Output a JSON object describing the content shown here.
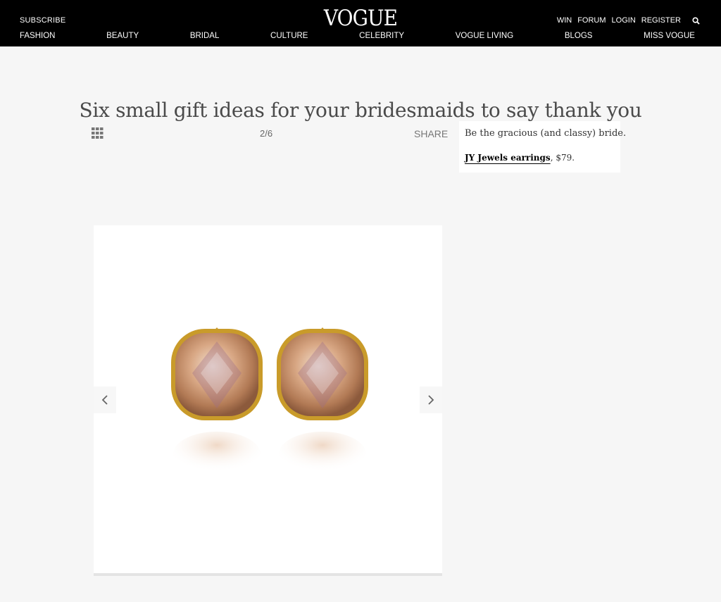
{
  "header": {
    "subscribe": "SUBSCRIBE",
    "logo": "VOGUE",
    "utility": [
      "WIN",
      "FORUM",
      "LOGIN",
      "REGISTER"
    ],
    "nav": [
      "FASHION",
      "BEAUTY",
      "BRIDAL",
      "CULTURE",
      "CELEBRITY",
      "VOGUE LIVING",
      "BLOGS",
      "MISS VOGUE"
    ]
  },
  "article": {
    "title": "Six small gift ideas for your bridesmaids to say thank you",
    "counter": "2/6",
    "share": "SHARE"
  },
  "caption": {
    "text": "Be the gracious (and classy) bride.",
    "link": "JY Jewels earrings",
    "price": ", $79."
  },
  "gallery": {
    "image_subject": "earrings",
    "stone_color": "#c9916a",
    "setting_color": "#c99b2a"
  },
  "icons": {
    "grid": "grid-icon",
    "search": "search-icon",
    "prev": "chevron-left-icon",
    "next": "chevron-right-icon"
  }
}
